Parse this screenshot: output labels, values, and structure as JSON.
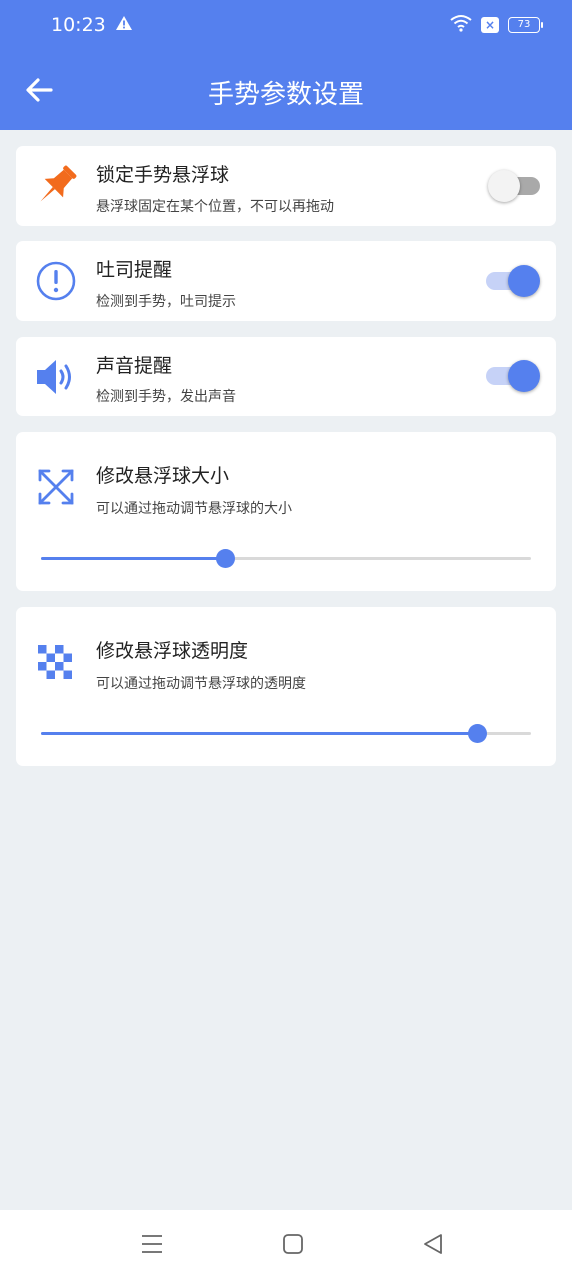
{
  "status_bar": {
    "time": "10:23",
    "battery": "73"
  },
  "app_bar": {
    "title": "手势参数设置"
  },
  "settings": {
    "lock_ball": {
      "title": "锁定手势悬浮球",
      "subtitle": "悬浮球固定在某个位置，不可以再拖动",
      "enabled": false
    },
    "toast_reminder": {
      "title": "吐司提醒",
      "subtitle": "检测到手势，吐司提示",
      "enabled": true
    },
    "sound_reminder": {
      "title": "声音提醒",
      "subtitle": "检测到手势，发出声音",
      "enabled": true
    },
    "ball_size": {
      "title": "修改悬浮球大小",
      "subtitle": "可以通过拖动调节悬浮球的大小",
      "value": 0.376
    },
    "ball_opacity": {
      "title": "修改悬浮球透明度",
      "subtitle": "可以通过拖动调节悬浮球的透明度",
      "value": 0.89
    }
  },
  "colors": {
    "accent": "#5580EE",
    "pin": "#F26B1D",
    "background": "#ECF0F3"
  },
  "icons": {
    "back": "arrow-left-icon",
    "lock": "pushpin-icon",
    "toast": "exclamation-circle-icon",
    "sound": "speaker-icon",
    "size": "expand-arrows-icon",
    "opacity": "checkerboard-icon"
  }
}
